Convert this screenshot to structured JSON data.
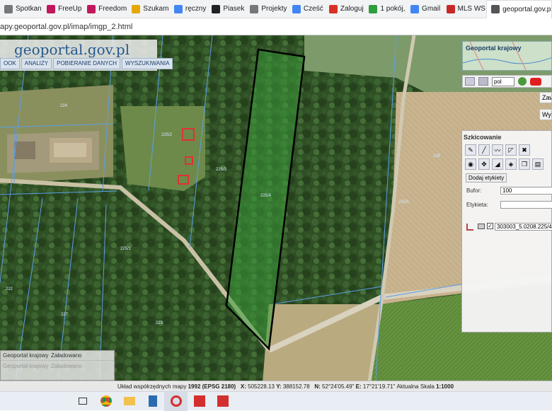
{
  "bookmarks": [
    {
      "label": "Spotkan",
      "icon": "globe-icon",
      "color": "#777777"
    },
    {
      "label": "FreeUp",
      "icon": "diamond-icon",
      "color": "#c2185b"
    },
    {
      "label": "Freedom",
      "icon": "diamond-icon",
      "color": "#c2185b"
    },
    {
      "label": "Szukam",
      "icon": "szukam-icon",
      "color": "#e6a800"
    },
    {
      "label": "ręczny",
      "icon": "google-icon",
      "color": "#4285f4"
    },
    {
      "label": "Piasek",
      "icon": "bookmark-icon",
      "color": "#222222"
    },
    {
      "label": "Projekty",
      "icon": "globe-icon",
      "color": "#777777"
    },
    {
      "label": "Cześć",
      "icon": "google-icon",
      "color": "#4285f4"
    },
    {
      "label": "Zaloguj",
      "icon": "red-square-icon",
      "color": "#d93025"
    },
    {
      "label": "1 pokój,",
      "icon": "green-square-icon",
      "color": "#2e9e3e"
    },
    {
      "label": "Gmail",
      "icon": "google-icon",
      "color": "#4285f4"
    },
    {
      "label": "MLS WS",
      "icon": "mls-icon",
      "color": "#c62828"
    },
    {
      "label": "geoportal.gov.pl",
      "icon": "geoportal-icon",
      "color": "#555555"
    }
  ],
  "address": "apy.geoportal.gov.pl/imap/imgp_2.html",
  "logo": {
    "text": "geoportal.gov.pl",
    "first_letter": "g"
  },
  "topnav": [
    "OOK",
    "ANALIZY",
    "POBIERANIE DANYCH",
    "WYSZUKIWANIA"
  ],
  "minimap": {
    "title": "Geoportal krajowy"
  },
  "toolbar_right": {
    "language": "pol"
  },
  "side_buttons": [
    "Zaw",
    "Wys"
  ],
  "sketch_panel": {
    "title": "Szkicowanie",
    "add_labels": "Dodaj etykiety",
    "buffer_label": "Bufor:",
    "buffer_value": "100",
    "label_label": "Etykieta:",
    "label_value": "",
    "parcel_id": "303003_5.0208.225/4"
  },
  "layers": [
    {
      "name": "Geoportal krajowy",
      "status": "Załadowano"
    },
    {
      "name": "Geoportal krajowy",
      "status": "Załadowano"
    }
  ],
  "status": {
    "prefix": "Układ współrzędnych mapy",
    "system": "1992 (EPSG 2180)",
    "x_label": "X:",
    "x": "505228.13",
    "y_label": "Y:",
    "y": "388152.78",
    "n_label": "N:",
    "n": "52°24'05.49\"",
    "e_label": "E:",
    "e": "17°21'19.71\"",
    "scale_label": "Aktualna Skala",
    "scale": "1:1000"
  },
  "parcel_labels": [
    "225/4",
    "225/3",
    "225/2",
    "225/1",
    "225/5",
    "224",
    "226",
    "227",
    "223",
    "222"
  ],
  "colors": {
    "selection_outline": "#000000",
    "selection_fill": "#3a9a3a",
    "parcel_lines": "#5aa0e6"
  }
}
